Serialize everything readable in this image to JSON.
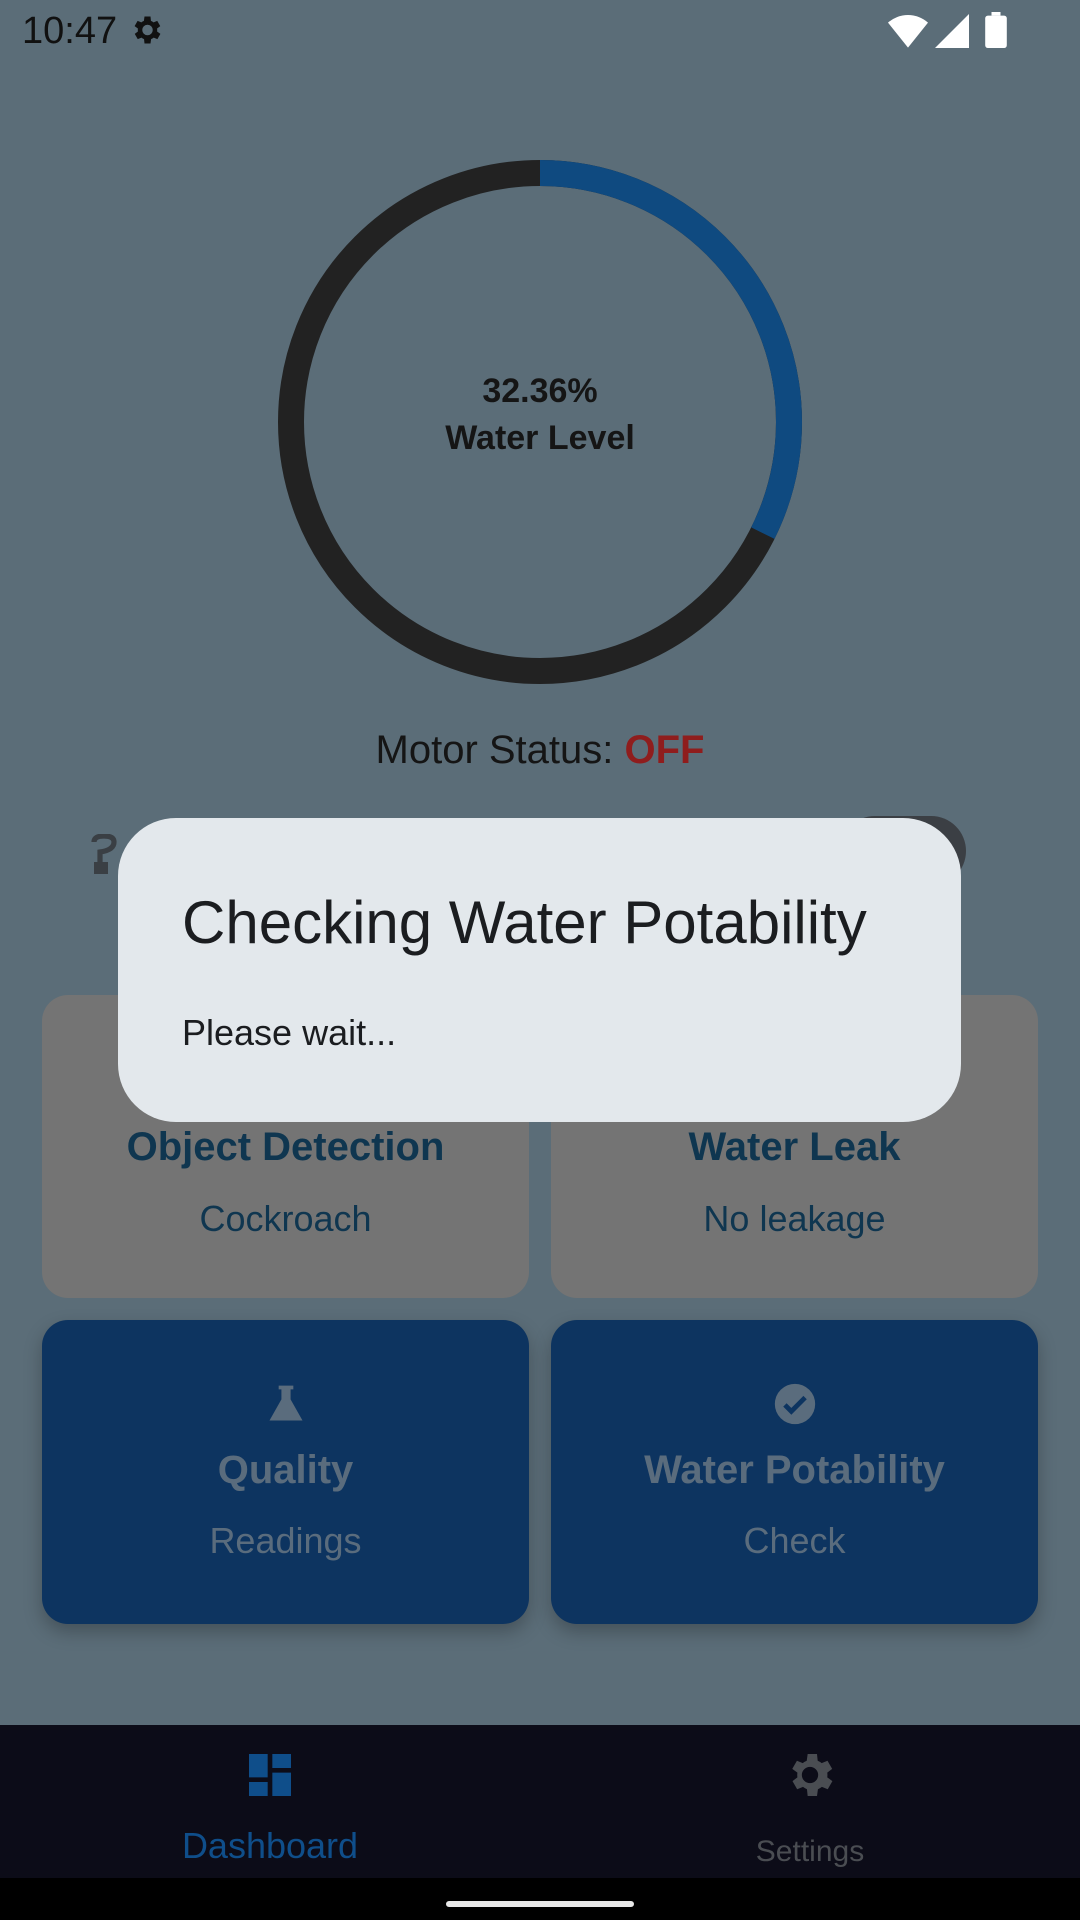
{
  "status_bar": {
    "time": "10:47"
  },
  "gauge": {
    "percent_text": "32.36%",
    "label": "Water Level",
    "fill_fraction": 0.3236,
    "fill_color": "#0f4a80",
    "track_color": "#222222"
  },
  "motor": {
    "label": "Motor Status: ",
    "state": "OFF",
    "state_color": "#8f1d1d"
  },
  "cards": {
    "object_detection": {
      "title": "Object Detection",
      "value": "Cockroach"
    },
    "water_leak": {
      "title": "Water Leak",
      "value": "No leakage"
    },
    "quality": {
      "title": "Quality",
      "sub": "Readings",
      "icon": "flask-icon"
    },
    "potability": {
      "title": "Water Potability",
      "sub": "Check",
      "icon": "check-circle-icon"
    }
  },
  "dialog": {
    "title": "Checking Water Potability",
    "message": "Please wait..."
  },
  "nav": {
    "dashboard": {
      "label": "Dashboard",
      "icon": "dashboard-icon",
      "active": true
    },
    "settings": {
      "label": "Settings",
      "icon": "gear-icon"
    }
  }
}
